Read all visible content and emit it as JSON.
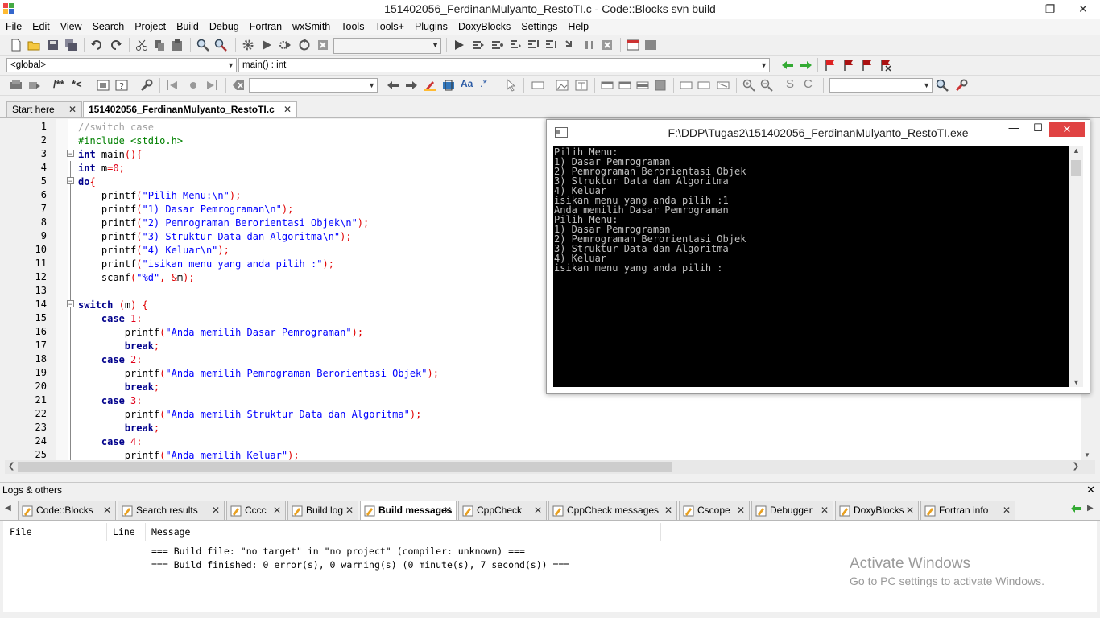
{
  "window": {
    "title": "151402056_FerdinanMulyanto_RestoTI.c - Code::Blocks svn build"
  },
  "menu": [
    "File",
    "Edit",
    "View",
    "Search",
    "Project",
    "Build",
    "Debug",
    "Fortran",
    "wxSmith",
    "Tools",
    "Tools+",
    "Plugins",
    "DoxyBlocks",
    "Settings",
    "Help"
  ],
  "toolbar": {
    "scope_combo": "<global>",
    "function_combo": "main() : int",
    "search_combo": "",
    "find_combo": ""
  },
  "editor_tabs": [
    {
      "label": "Start here",
      "active": false
    },
    {
      "label": "151402056_FerdinanMulyanto_RestoTI.c",
      "active": true
    }
  ],
  "editor": {
    "line_numbers": [
      "1",
      "2",
      "3",
      "4",
      "5",
      "6",
      "7",
      "8",
      "9",
      "10",
      "11",
      "12",
      "13",
      "14",
      "15",
      "16",
      "17",
      "18",
      "19",
      "20",
      "21",
      "22",
      "23",
      "24",
      "25"
    ],
    "lines": [
      "//switch case",
      "#include <stdio.h>",
      "int main(){",
      "int m=0;",
      "do{",
      "    printf(\"Pilih Menu:\\n\");",
      "    printf(\"1) Dasar Pemrograman\\n\");",
      "    printf(\"2) Pemrograman Berorientasi Objek\\n\");",
      "    printf(\"3) Struktur Data dan Algoritma\\n\");",
      "    printf(\"4) Keluar\\n\");",
      "    printf(\"isikan menu yang anda pilih :\");",
      "    scanf(\"%d\", &m);",
      "",
      "switch (m) {",
      "    case 1:",
      "        printf(\"Anda memilih Dasar Pemrograman\");",
      "        break;",
      "    case 2:",
      "        printf(\"Anda memilih Pemrograman Berorientasi Objek\");",
      "        break;",
      "    case 3:",
      "        printf(\"Anda memilih Struktur Data dan Algoritma\");",
      "        break;",
      "    case 4:",
      "        printf(\"Anda memilih Keluar\");"
    ]
  },
  "console": {
    "title": "F:\\DDP\\Tugas2\\151402056_FerdinanMulyanto_RestoTI.exe",
    "output": "Pilih Menu:\n1) Dasar Pemrograman\n2) Pemrograman Berorientasi Objek\n3) Struktur Data dan Algoritma\n4) Keluar\nisikan menu yang anda pilih :1\nAnda memilih Dasar Pemrograman\nPilih Menu:\n1) Dasar Pemrograman\n2) Pemrograman Berorientasi Objek\n3) Struktur Data dan Algoritma\n4) Keluar\nisikan menu yang anda pilih :"
  },
  "logs": {
    "title": "Logs & others",
    "tabs": [
      "Code::Blocks",
      "Search results",
      "Cccc",
      "Build log",
      "Build messages",
      "CppCheck",
      "CppCheck messages",
      "Cscope",
      "Debugger",
      "DoxyBlocks",
      "Fortran info"
    ],
    "active_tab": "Build messages",
    "columns": [
      "File",
      "Line",
      "Message"
    ],
    "messages": [
      "=== Build file: \"no target\" in \"no project\" (compiler: unknown) ===",
      "=== Build finished: 0 error(s), 0 warning(s) (0 minute(s), 7 second(s)) ==="
    ]
  },
  "watermark": {
    "line1": "Activate Windows",
    "line2": "Go to PC settings to activate Windows."
  },
  "colors": {
    "console_bg": "#000000",
    "console_fg": "#c0c0c0",
    "close_red": "#e04343"
  }
}
